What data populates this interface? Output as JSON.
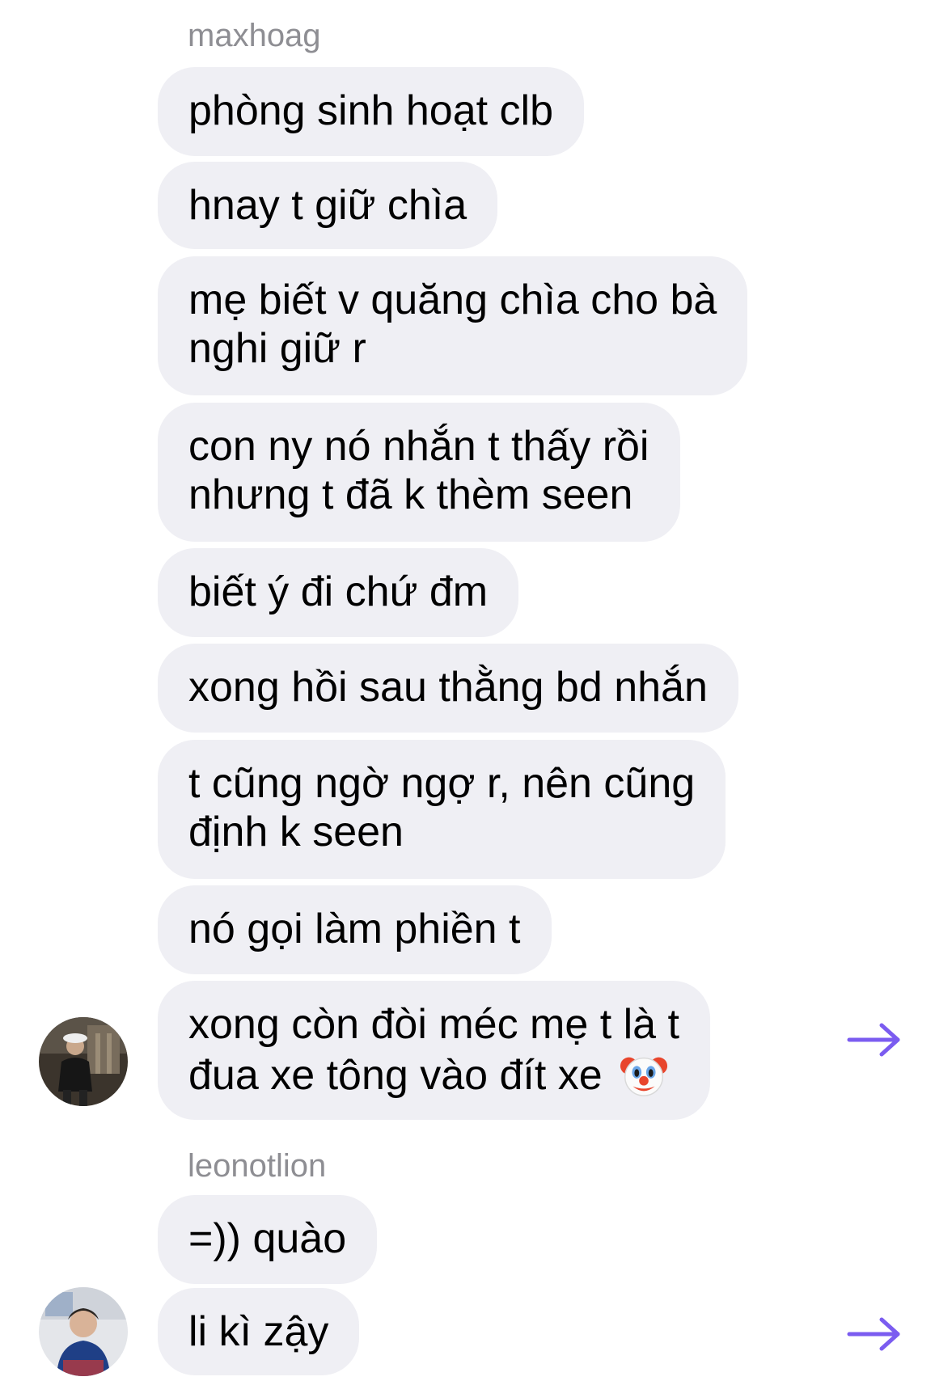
{
  "conversation": {
    "groups": [
      {
        "sender": "maxhoag",
        "avatar_icon": "user-avatar-photo-icon",
        "messages": [
          [
            "phòng sinh hoạt clb"
          ],
          [
            "hnay t giữ chìa"
          ],
          [
            "mẹ biết v quăng chìa cho bà",
            "nghi giữ r"
          ],
          [
            "con ny nó nhắn t thấy rồi",
            "nhưng t đã k thèm seen"
          ],
          [
            "biết ý đi chứ đm"
          ],
          [
            "xong hồi sau thằng bd nhắn"
          ],
          [
            "t cũng ngờ ngợ r, nên cũng",
            "định k seen"
          ],
          [
            "nó gọi làm phiền t"
          ],
          [
            "xong còn đòi méc mẹ t là t",
            "đua xe tông vào đít xe"
          ]
        ],
        "last_message_emoji": "clown-face-icon",
        "forward_icon": "share-arrow-icon"
      },
      {
        "sender": "leonotlion",
        "avatar_icon": "user-avatar-photo-icon",
        "messages": [
          [
            "=)) quào"
          ],
          [
            "li kì zậy"
          ]
        ],
        "forward_icon": "share-arrow-icon"
      }
    ]
  },
  "colors": {
    "bubble_bg": "#efeff4",
    "sender_name": "#8e8e93",
    "forward_arrow": "#7b5cf0",
    "text": "#000000"
  }
}
